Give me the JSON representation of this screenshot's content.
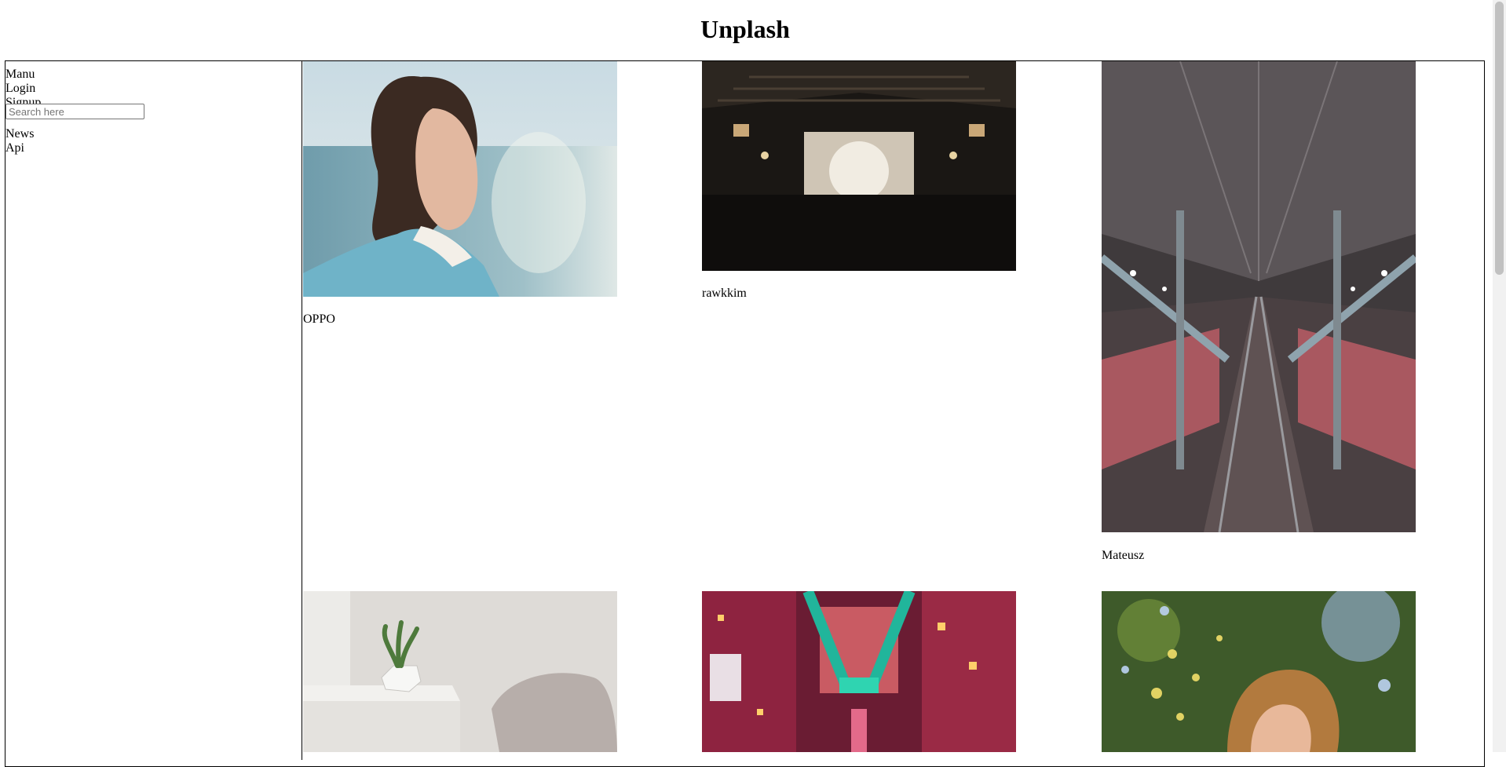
{
  "page": {
    "title": "Unplash"
  },
  "sidebar": {
    "items": [
      {
        "label": "Manu"
      },
      {
        "label": "Login"
      },
      {
        "label": "Signup"
      },
      {
        "label": "News"
      },
      {
        "label": "Api"
      }
    ],
    "search": {
      "placeholder": "Search here",
      "value": ""
    }
  },
  "gallery": {
    "photos": [
      {
        "author": "OPPO",
        "subject": "woman-by-sea"
      },
      {
        "author": "rawkkim",
        "subject": "dark-hall-interior"
      },
      {
        "author": "Mateusz",
        "subject": "railway-station"
      },
      {
        "author": "",
        "subject": "plant-on-table"
      },
      {
        "author": "",
        "subject": "neon-street"
      },
      {
        "author": "",
        "subject": "woman-with-bokeh"
      }
    ]
  }
}
